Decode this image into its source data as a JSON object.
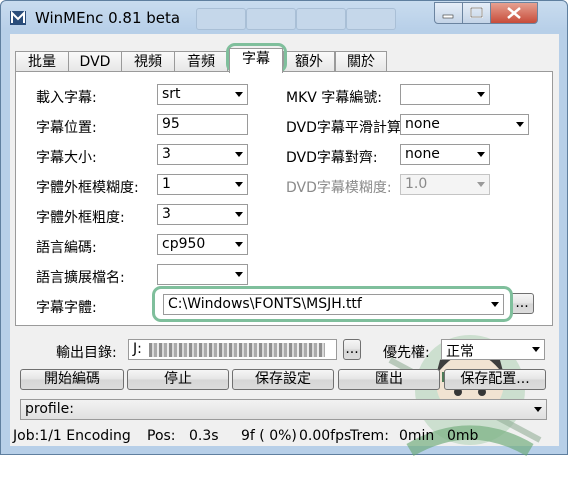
{
  "window": {
    "title": "WinMEnc 0.81 beta"
  },
  "tabs": [
    {
      "label": "批量"
    },
    {
      "label": "DVD"
    },
    {
      "label": "視頻"
    },
    {
      "label": "音頻"
    },
    {
      "label": "字幕",
      "active": true
    },
    {
      "label": "額外"
    },
    {
      "label": "關於"
    }
  ],
  "subtitle": {
    "load_label": "載入字幕:",
    "load_value": "srt",
    "position_label": "字幕位置:",
    "position_value": "95",
    "size_label": "字幕大小:",
    "size_value": "3",
    "outline_blur_label": "字體外框模糊度:",
    "outline_blur_value": "1",
    "outline_thick_label": "字體外框粗度:",
    "outline_thick_value": "3",
    "encoding_label": "語言編碼:",
    "encoding_value": "cp950",
    "ext_label": "語言擴展檔名:",
    "ext_value": "",
    "font_label": "字幕字體:",
    "font_value": "C:\\Windows\\FONTS\\MSJH.ttf",
    "font_browse": "...",
    "mkv_label": "MKV 字幕編號:",
    "mkv_value": "",
    "dvd_smooth_label": "DVD字幕平滑計算:",
    "dvd_smooth_value": "none",
    "dvd_align_label": "DVD字幕對齊:",
    "dvd_align_value": "none",
    "dvd_blur_label": "DVD字幕模糊度:",
    "dvd_blur_value": "1.0"
  },
  "output": {
    "label": "輸出目錄:",
    "path_prefix": "J:",
    "browse": "...",
    "priority_label": "優先權:",
    "priority_value": "正常"
  },
  "buttons": {
    "start": "開始編碼",
    "stop": "停止",
    "save_settings": "保存設定",
    "export": "匯出",
    "save_config": "保存配置..."
  },
  "profile": {
    "value": "profile:"
  },
  "status": {
    "job": "Job:1/1 Encoding",
    "pos": "Pos:",
    "pos_value": "0.3s",
    "frames": "9f ( 0%)",
    "fps": "0.00fps",
    "trem": "Trem:",
    "trem_value": "0min",
    "size": "0mb"
  },
  "colors": {
    "highlight": "#7fbf9c",
    "titlebar": "#b7cfe8",
    "close": "#c74c3a"
  }
}
